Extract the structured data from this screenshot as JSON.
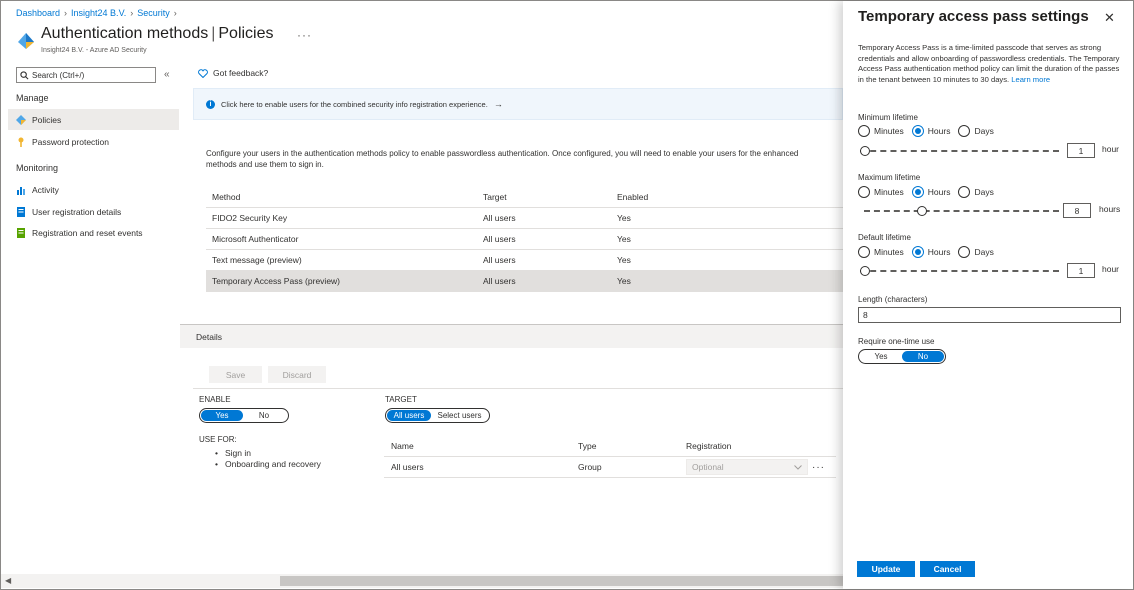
{
  "breadcrumb": [
    "Dashboard",
    "Insight24 B.V.",
    "Security"
  ],
  "header": {
    "title": "Authentication methods",
    "title_separator": "|",
    "title_section": "Policies",
    "more": "···",
    "subtitle": "Insight24 B.V. - Azure AD Security"
  },
  "sidebar": {
    "search_placeholder": "Search (Ctrl+/)",
    "collapse": "«",
    "groups": [
      {
        "label": "Manage",
        "items": [
          {
            "label": "Policies",
            "icon": "diamond-icon",
            "active": true
          },
          {
            "label": "Password protection",
            "icon": "key-icon"
          }
        ]
      },
      {
        "label": "Monitoring",
        "items": [
          {
            "label": "Activity",
            "icon": "chart-icon"
          },
          {
            "label": "User registration details",
            "icon": "document-icon"
          },
          {
            "label": "Registration and reset events",
            "icon": "registration-icon"
          }
        ]
      }
    ]
  },
  "main": {
    "feedback": "Got feedback?",
    "info_bar": "Click here to enable users for the combined security info registration experience.",
    "info_arrow": "→",
    "intro_line1": "Configure your users in the authentication methods policy to enable passwordless authentication. Once configured, you will need to enable your users for the enhanced",
    "intro_line2": "methods and use them to sign in.",
    "table": {
      "headers": [
        "Method",
        "Target",
        "Enabled"
      ],
      "rows": [
        [
          "FIDO2 Security Key",
          "All users",
          "Yes"
        ],
        [
          "Microsoft Authenticator",
          "All users",
          "Yes"
        ],
        [
          "Text message (preview)",
          "All users",
          "Yes"
        ],
        [
          "Temporary Access Pass (preview)",
          "All users",
          "Yes"
        ]
      ]
    }
  },
  "details": {
    "title": "Details",
    "save": "Save",
    "discard": "Discard",
    "enable_label": "ENABLE",
    "enable_options": [
      "Yes",
      "No"
    ],
    "use_for_label": "USE FOR:",
    "use_for": [
      "Sign in",
      "Onboarding and recovery"
    ],
    "target_label": "TARGET",
    "target_options": [
      "All users",
      "Select users"
    ],
    "target_table": {
      "headers": [
        "Name",
        "Type",
        "Registration"
      ],
      "rows": [
        {
          "name": "All users",
          "type": "Group",
          "registration": "Optional"
        }
      ]
    },
    "row_more": "···"
  },
  "panel": {
    "title": "Temporary access pass settings",
    "close": "✕",
    "description": "Temporary Access Pass is a time-limited passcode that serves as strong credentials and allow onboarding of passwordless credentials. The Temporary Access Pass authentication method policy can limit the duration of the passes in the tenant between 10 minutes to 30 days.",
    "learn_more": "Learn more",
    "unit_options": [
      "Minutes",
      "Hours",
      "Days"
    ],
    "min_lifetime": {
      "label": "Minimum lifetime",
      "unit": "Hours",
      "value": "1",
      "unit_label": "hour",
      "slider_fraction": 0.0
    },
    "max_lifetime": {
      "label": "Maximum lifetime",
      "unit": "Hours",
      "value": "8",
      "unit_label": "hours",
      "slider_fraction": 0.3
    },
    "default_lifetime": {
      "label": "Default lifetime",
      "unit": "Hours",
      "value": "1",
      "unit_label": "hour",
      "slider_fraction": 0.0
    },
    "length": {
      "label": "Length (characters)",
      "value": "8"
    },
    "one_time": {
      "label": "Require one-time use",
      "options": [
        "Yes",
        "No"
      ],
      "selected": "No"
    },
    "update": "Update",
    "cancel": "Cancel"
  },
  "colors": {
    "accent": "#0078d4",
    "selected_row": "#e1dfdd",
    "info_bg": "#f0f6fc"
  }
}
